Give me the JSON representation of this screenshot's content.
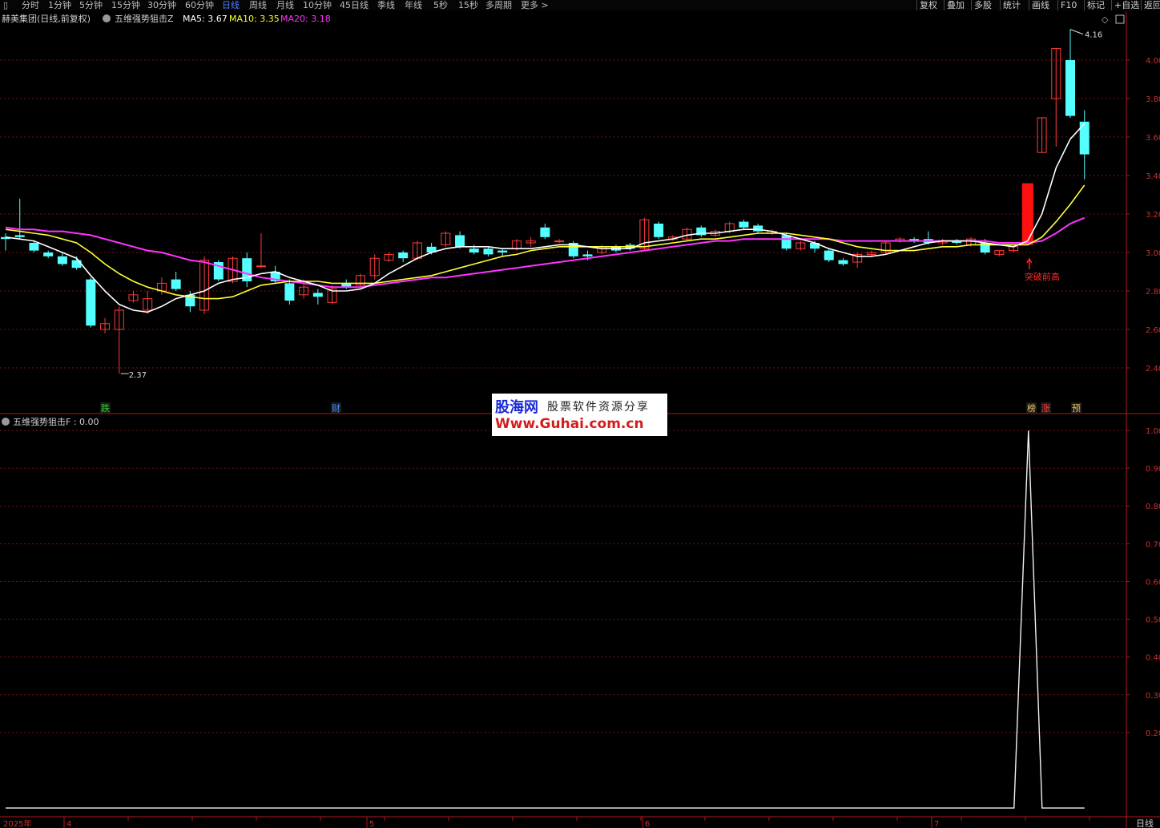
{
  "toolbar": {
    "tabs": [
      {
        "label": "分时",
        "active": false
      },
      {
        "label": "1分钟",
        "active": false
      },
      {
        "label": "5分钟",
        "active": false
      },
      {
        "label": "15分钟",
        "active": false
      },
      {
        "label": "30分钟",
        "active": false
      },
      {
        "label": "60分钟",
        "active": false
      },
      {
        "label": "日线",
        "active": true
      },
      {
        "label": "周线",
        "active": false
      },
      {
        "label": "月线",
        "active": false
      },
      {
        "label": "10分钟",
        "active": false
      },
      {
        "label": "45日线",
        "active": false
      },
      {
        "label": "季线",
        "active": false
      },
      {
        "label": "年线",
        "active": false
      },
      {
        "label": "5秒",
        "active": false
      },
      {
        "label": "15秒",
        "active": false
      },
      {
        "label": "多周期",
        "active": false
      },
      {
        "label": "更多 >",
        "active": false
      }
    ],
    "right_buttons": [
      "复权",
      "叠加",
      "多股",
      "统计",
      "画线",
      "F10",
      "标记",
      "+自选",
      "返回"
    ]
  },
  "main_chart": {
    "stock_name": "赫美集团(日线,前复权)",
    "indicator_name": "五维强势狙击Z",
    "ma5_label": "MA5: 3.67",
    "ma10_label": "MA10: 3.35",
    "ma20_label": "MA20: 3.18",
    "y_ticks": [
      "4.00",
      "3.80",
      "3.60",
      "3.40",
      "3.20",
      "3.00",
      "2.80",
      "2.60",
      "2.40"
    ],
    "high_label": "4.16",
    "low_label": "2.37",
    "breakout_label": "突破前高",
    "markers": [
      {
        "text": "跌",
        "color": "#2fd62f"
      },
      {
        "text": "财",
        "color": "#3f8fff"
      },
      {
        "text": "榜",
        "color": "#e8c25a"
      },
      {
        "text": "涨",
        "color": "#ff4444"
      },
      {
        "text": "预",
        "color": "#e8c25a"
      }
    ]
  },
  "sub_chart": {
    "indicator_label": "五维强势狙击F : 0.00",
    "y_ticks": [
      "1.00",
      "0.90",
      "0.80",
      "0.70",
      "0.60",
      "0.50",
      "0.40",
      "0.30",
      "0.20"
    ]
  },
  "x_axis": {
    "labels": [
      "2025年",
      "4",
      "5",
      "6",
      "7"
    ],
    "period_label": "日线"
  },
  "watermark": {
    "line1a": "股海网",
    "line1b": "股票软件资源分享",
    "line2": "Www.Guhai.com.cn"
  },
  "colors": {
    "up": "#ff3b3b",
    "down": "#54ffff",
    "ma5": "#ffffff",
    "ma10": "#ffff33",
    "ma20": "#ff33ff",
    "grid": "#7a1010",
    "axis": "#b01818"
  },
  "chart_data": {
    "type": "candlestick",
    "ylim": [
      2.25,
      4.25
    ],
    "candles": [
      [
        3.08,
        3.07,
        3.1,
        3.01
      ],
      [
        3.09,
        3.08,
        3.28,
        3.07
      ],
      [
        3.05,
        3.01,
        3.06,
        3.0
      ],
      [
        3.0,
        2.98,
        3.01,
        2.97
      ],
      [
        2.98,
        2.94,
        3.0,
        2.93
      ],
      [
        2.96,
        2.92,
        2.98,
        2.91
      ],
      [
        2.86,
        2.62,
        2.87,
        2.61
      ],
      [
        2.6,
        2.63,
        2.66,
        2.58
      ],
      [
        2.6,
        2.7,
        2.72,
        2.37
      ],
      [
        2.75,
        2.78,
        2.8,
        2.74
      ],
      [
        2.7,
        2.76,
        2.8,
        2.68
      ],
      [
        2.8,
        2.84,
        2.87,
        2.78
      ],
      [
        2.86,
        2.81,
        2.9,
        2.8
      ],
      [
        2.78,
        2.72,
        2.8,
        2.69
      ],
      [
        2.7,
        2.96,
        2.98,
        2.68
      ],
      [
        2.95,
        2.86,
        2.96,
        2.85
      ],
      [
        2.85,
        2.97,
        2.98,
        2.84
      ],
      [
        2.97,
        2.85,
        3.0,
        2.82
      ],
      [
        2.93,
        2.93,
        3.1,
        2.92
      ],
      [
        2.9,
        2.85,
        2.93,
        2.84
      ],
      [
        2.84,
        2.75,
        2.86,
        2.73
      ],
      [
        2.78,
        2.82,
        2.86,
        2.76
      ],
      [
        2.79,
        2.77,
        2.81,
        2.73
      ],
      [
        2.74,
        2.81,
        2.83,
        2.73
      ],
      [
        2.84,
        2.82,
        2.86,
        2.81
      ],
      [
        2.83,
        2.88,
        2.89,
        2.82
      ],
      [
        2.88,
        2.97,
        2.99,
        2.86
      ],
      [
        2.96,
        2.99,
        3.0,
        2.95
      ],
      [
        3.0,
        2.97,
        3.01,
        2.95
      ],
      [
        2.97,
        3.05,
        3.06,
        2.96
      ],
      [
        3.03,
        3.0,
        3.05,
        2.99
      ],
      [
        3.04,
        3.1,
        3.11,
        3.03
      ],
      [
        3.09,
        3.03,
        3.11,
        3.02
      ],
      [
        3.02,
        3.0,
        3.04,
        2.99
      ],
      [
        3.02,
        2.99,
        3.03,
        2.98
      ],
      [
        3.01,
        3.0,
        3.02,
        2.98
      ],
      [
        3.02,
        3.06,
        3.07,
        3.01
      ],
      [
        3.05,
        3.06,
        3.08,
        3.03
      ],
      [
        3.13,
        3.08,
        3.15,
        3.07
      ],
      [
        3.06,
        3.06,
        3.07,
        3.05
      ],
      [
        3.05,
        2.98,
        3.06,
        2.97
      ],
      [
        2.99,
        2.98,
        3.01,
        2.96
      ],
      [
        3.0,
        3.03,
        3.04,
        2.99
      ],
      [
        3.03,
        3.01,
        3.04,
        3.0
      ],
      [
        3.04,
        3.02,
        3.05,
        3.01
      ],
      [
        3.02,
        3.17,
        3.18,
        3.01
      ],
      [
        3.15,
        3.08,
        3.16,
        3.07
      ],
      [
        3.07,
        3.08,
        3.09,
        3.06
      ],
      [
        3.07,
        3.12,
        3.13,
        3.06
      ],
      [
        3.13,
        3.09,
        3.14,
        3.08
      ],
      [
        3.09,
        3.11,
        3.12,
        3.08
      ],
      [
        3.11,
        3.15,
        3.16,
        3.1
      ],
      [
        3.16,
        3.13,
        3.17,
        3.12
      ],
      [
        3.14,
        3.11,
        3.15,
        3.1
      ],
      [
        3.1,
        3.11,
        3.12,
        3.09
      ],
      [
        3.09,
        3.02,
        3.1,
        3.01
      ],
      [
        3.02,
        3.05,
        3.06,
        3.01
      ],
      [
        3.05,
        3.02,
        3.06,
        3.0
      ],
      [
        3.01,
        2.96,
        3.02,
        2.95
      ],
      [
        2.96,
        2.94,
        2.97,
        2.93
      ],
      [
        2.95,
        2.99,
        3.0,
        2.92
      ],
      [
        2.99,
        3.0,
        3.01,
        2.98
      ],
      [
        3.0,
        3.05,
        3.06,
        2.99
      ],
      [
        3.06,
        3.07,
        3.08,
        3.05
      ],
      [
        3.07,
        3.06,
        3.08,
        3.05
      ],
      [
        3.07,
        3.05,
        3.11,
        3.04
      ],
      [
        3.05,
        3.06,
        3.07,
        3.04
      ],
      [
        3.06,
        3.05,
        3.07,
        3.04
      ],
      [
        3.04,
        3.07,
        3.08,
        3.03
      ],
      [
        3.05,
        3.0,
        3.07,
        2.99
      ],
      [
        2.99,
        3.01,
        3.01,
        2.98
      ],
      [
        3.01,
        3.03,
        3.03,
        3.0
      ],
      [
        3.04,
        3.36,
        3.36,
        3.04
      ],
      [
        3.52,
        3.7,
        3.7,
        3.52
      ],
      [
        3.8,
        4.06,
        4.06,
        3.55
      ],
      [
        4.0,
        3.71,
        4.16,
        3.7
      ],
      [
        3.68,
        3.51,
        3.74,
        3.38
      ]
    ],
    "ma5": [
      3.08,
      3.07,
      3.06,
      3.03,
      3.0,
      2.97,
      2.88,
      2.8,
      2.73,
      2.7,
      2.69,
      2.72,
      2.76,
      2.78,
      2.8,
      2.84,
      2.86,
      2.87,
      2.89,
      2.9,
      2.87,
      2.85,
      2.83,
      2.8,
      2.8,
      2.81,
      2.84,
      2.89,
      2.93,
      2.97,
      3.0,
      3.02,
      3.03,
      3.03,
      3.03,
      3.02,
      3.02,
      3.02,
      3.03,
      3.04,
      3.04,
      3.03,
      3.02,
      3.02,
      3.02,
      3.05,
      3.06,
      3.07,
      3.09,
      3.1,
      3.1,
      3.11,
      3.12,
      3.12,
      3.11,
      3.09,
      3.07,
      3.05,
      3.02,
      3.0,
      2.98,
      2.98,
      2.99,
      3.01,
      3.03,
      3.05,
      3.06,
      3.06,
      3.06,
      3.05,
      3.04,
      3.03,
      3.06,
      3.2,
      3.44,
      3.59,
      3.67
    ],
    "ma10": [
      3.12,
      3.11,
      3.1,
      3.09,
      3.07,
      3.05,
      3.0,
      2.94,
      2.89,
      2.85,
      2.82,
      2.8,
      2.78,
      2.77,
      2.76,
      2.76,
      2.77,
      2.8,
      2.83,
      2.84,
      2.85,
      2.85,
      2.85,
      2.84,
      2.84,
      2.84,
      2.84,
      2.85,
      2.86,
      2.87,
      2.88,
      2.9,
      2.92,
      2.94,
      2.96,
      2.98,
      2.99,
      3.01,
      3.02,
      3.03,
      3.03,
      3.03,
      3.03,
      3.03,
      3.03,
      3.03,
      3.04,
      3.05,
      3.06,
      3.07,
      3.07,
      3.08,
      3.09,
      3.1,
      3.1,
      3.1,
      3.09,
      3.08,
      3.07,
      3.05,
      3.03,
      3.02,
      3.01,
      3.01,
      3.01,
      3.02,
      3.03,
      3.03,
      3.04,
      3.04,
      3.04,
      3.04,
      3.04,
      3.08,
      3.16,
      3.25,
      3.35
    ],
    "ma20": [
      3.13,
      3.12,
      3.12,
      3.11,
      3.11,
      3.1,
      3.09,
      3.07,
      3.05,
      3.03,
      3.01,
      3.0,
      2.98,
      2.96,
      2.95,
      2.93,
      2.91,
      2.89,
      2.87,
      2.86,
      2.85,
      2.84,
      2.83,
      2.82,
      2.82,
      2.82,
      2.83,
      2.84,
      2.85,
      2.86,
      2.87,
      2.87,
      2.88,
      2.89,
      2.9,
      2.91,
      2.92,
      2.93,
      2.94,
      2.95,
      2.96,
      2.97,
      2.98,
      2.99,
      3.0,
      3.01,
      3.02,
      3.03,
      3.04,
      3.05,
      3.06,
      3.06,
      3.07,
      3.07,
      3.07,
      3.07,
      3.07,
      3.07,
      3.07,
      3.06,
      3.06,
      3.06,
      3.06,
      3.06,
      3.06,
      3.06,
      3.06,
      3.06,
      3.06,
      3.06,
      3.05,
      3.05,
      3.05,
      3.06,
      3.1,
      3.15,
      3.18
    ],
    "signal_candle_index": 72,
    "high_candle_index": 75,
    "low_candle_index": 8,
    "sub_series": [
      0,
      0,
      0,
      0,
      0,
      0,
      0,
      0,
      0,
      0,
      0,
      0,
      0,
      0,
      0,
      0,
      0,
      0,
      0,
      0,
      0,
      0,
      0,
      0,
      0,
      0,
      0,
      0,
      0,
      0,
      0,
      0,
      0,
      0,
      0,
      0,
      0,
      0,
      0,
      0,
      0,
      0,
      0,
      0,
      0,
      0,
      0,
      0,
      0,
      0,
      0,
      0,
      0,
      0,
      0,
      0,
      0,
      0,
      0,
      0,
      0,
      0,
      0,
      0,
      0,
      0,
      0,
      0,
      0,
      0,
      0,
      0,
      1,
      0,
      0,
      0,
      0
    ],
    "sub_ylim": [
      0.12,
      1.03
    ]
  }
}
